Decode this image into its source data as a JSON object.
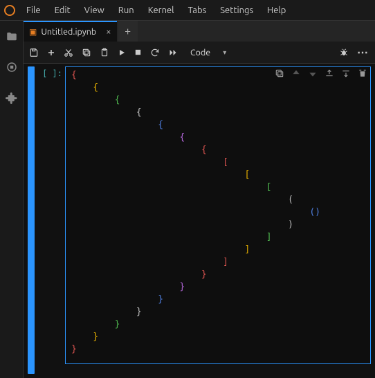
{
  "menu": {
    "items": [
      "File",
      "Edit",
      "View",
      "Run",
      "Kernel",
      "Tabs",
      "Settings",
      "Help"
    ]
  },
  "sidebar": {
    "icons": [
      "folder",
      "running",
      "extensions"
    ]
  },
  "tab": {
    "title": "Untitled.ipynb"
  },
  "toolbar": {
    "save": "save",
    "add": "add",
    "cut": "cut",
    "copy": "copy",
    "paste": "paste",
    "run": "run",
    "stop": "stop",
    "restart": "restart",
    "ff": "run-all",
    "celltype": "Code",
    "debug": "debug",
    "more": "more"
  },
  "cell": {
    "prompt": "[ ]:",
    "lines": [
      {
        "indent": 0,
        "text": "{",
        "color": "#d9534f"
      },
      {
        "indent": 1,
        "text": "{",
        "color": "#e6b000"
      },
      {
        "indent": 2,
        "text": "{",
        "color": "#4fb84f"
      },
      {
        "indent": 3,
        "text": "{",
        "color": "#bbbbbb"
      },
      {
        "indent": 4,
        "text": "{",
        "color": "#4f7fe0"
      },
      {
        "indent": 5,
        "text": "{",
        "color": "#b366d9"
      },
      {
        "indent": 6,
        "text": "{",
        "color": "#d9534f"
      },
      {
        "indent": 7,
        "text": "[",
        "color": "#d9534f"
      },
      {
        "indent": 8,
        "text": "[",
        "color": "#e6b000"
      },
      {
        "indent": 9,
        "text": "[",
        "color": "#4fb84f"
      },
      {
        "indent": 10,
        "text": "(",
        "color": "#bbbbbb"
      },
      {
        "indent": 11,
        "text": "()",
        "color": "#4f7fe0"
      },
      {
        "indent": 10,
        "text": ")",
        "color": "#bbbbbb"
      },
      {
        "indent": 9,
        "text": "]",
        "color": "#4fb84f"
      },
      {
        "indent": 8,
        "text": "]",
        "color": "#e6b000"
      },
      {
        "indent": 7,
        "text": "]",
        "color": "#d9534f"
      },
      {
        "indent": 6,
        "text": "}",
        "color": "#d9534f"
      },
      {
        "indent": 5,
        "text": "}",
        "color": "#b366d9"
      },
      {
        "indent": 4,
        "text": "}",
        "color": "#4f7fe0"
      },
      {
        "indent": 3,
        "text": "}",
        "color": "#bbbbbb"
      },
      {
        "indent": 2,
        "text": "}",
        "color": "#4fb84f"
      },
      {
        "indent": 1,
        "text": "}",
        "color": "#e6b000"
      },
      {
        "indent": 0,
        "text": "}",
        "color": "#d9534f"
      }
    ]
  }
}
